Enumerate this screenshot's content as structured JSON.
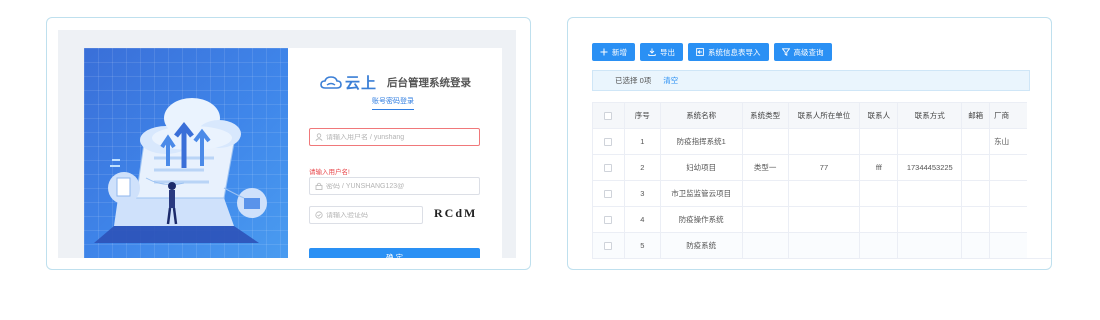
{
  "login": {
    "brand_name": "云上",
    "title": "后台管理系统登录",
    "tab_label": "账号密码登录",
    "username_placeholder": "请输入用户名 / yunshang",
    "username_error": "请输入用户名!",
    "password_placeholder": "密码 / YUNSHANG123@",
    "captcha_placeholder": "请输入验证码",
    "captcha_text": "RCdM",
    "submit_label": "确 定",
    "accent_color": "#2a90f4",
    "error_color": "#e8474b"
  },
  "table_view": {
    "toolbar": {
      "add_label": "新增",
      "export_label": "导出",
      "import_label": "系统信息表导入",
      "advanced_search_label": "高级查询"
    },
    "selection": {
      "text": "已选择 0项",
      "clear_label": "清空"
    },
    "columns": [
      "序号",
      "系统名称",
      "系统类型",
      "联系人所在单位",
      "联系人",
      "联系方式",
      "邮箱",
      "厂商"
    ],
    "rows": [
      {
        "no": "1",
        "name": "防疫指挥系统1",
        "type": "",
        "unit": "",
        "contact": "",
        "phone": "",
        "email": "",
        "vendor": "东山"
      },
      {
        "no": "2",
        "name": "妇幼项目",
        "type": "类型一",
        "unit": "77",
        "contact": "fff",
        "phone": "17344453225",
        "email": "",
        "vendor": ""
      },
      {
        "no": "3",
        "name": "市卫监监管云项目",
        "type": "",
        "unit": "",
        "contact": "",
        "phone": "",
        "email": "",
        "vendor": ""
      },
      {
        "no": "4",
        "name": "防疫操作系统",
        "type": "",
        "unit": "",
        "contact": "",
        "phone": "",
        "email": "",
        "vendor": ""
      },
      {
        "no": "5",
        "name": "防疫系统",
        "type": "",
        "unit": "",
        "contact": "",
        "phone": "",
        "email": "",
        "vendor": ""
      }
    ]
  }
}
